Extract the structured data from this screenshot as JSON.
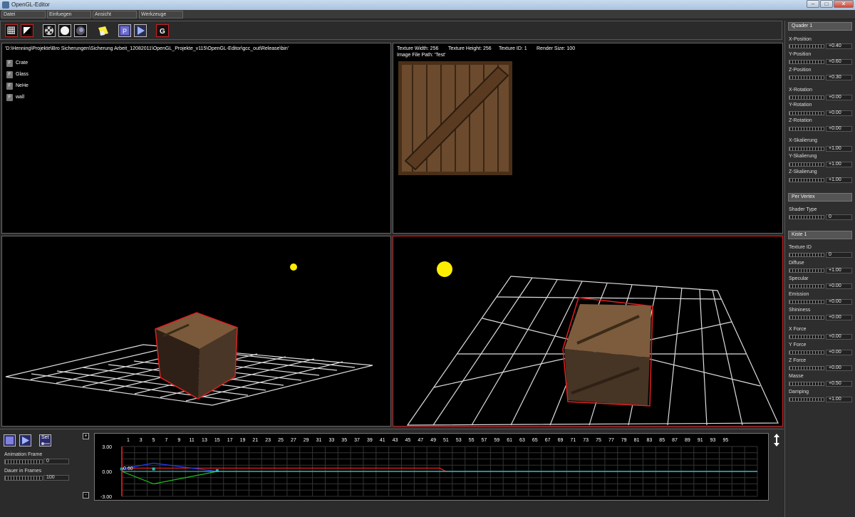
{
  "window": {
    "title": "OpenGL-Editor"
  },
  "menu": [
    "Datei",
    "Einfuegen",
    "Ansicht",
    "Werkzeuge"
  ],
  "toolbar": {
    "g_label": "G",
    "p_label": "P",
    "icons": [
      "grid-icon",
      "contrast-icon",
      "checker-icon",
      "sphere-white-icon",
      "sphere-blue-icon",
      "light-icon",
      "p-icon",
      "play-icon",
      "g-icon"
    ]
  },
  "file_browser": {
    "path": "'D:\\Henning\\Projekte\\Bro Sicherungen\\Sicherung Arbeit_12082011\\OpenGL_Projekte_v115\\OpenGL-Editor\\gcc_out\\Release\\bin'",
    "items": [
      {
        "icon": "F",
        "name": "Crate"
      },
      {
        "icon": "F",
        "name": "Glass"
      },
      {
        "icon": "F",
        "name": "NeHe"
      },
      {
        "icon": "F",
        "name": "wall"
      }
    ]
  },
  "texture_info": {
    "width_label": "Texture Width: 256",
    "height_label": "Texture Height: 256",
    "id_label": "Texture ID: 1",
    "render_label": "Render Size: 100",
    "path_label": "Image File Path: 'Test'"
  },
  "properties": {
    "object_name": "Quader 1",
    "transform": [
      {
        "label": "X-Position",
        "value": "+0.40"
      },
      {
        "label": "Y-Position",
        "value": "+0.60"
      },
      {
        "label": "Z-Position",
        "value": "+0.30"
      },
      {
        "label": "X-Rotation",
        "value": "+0.00"
      },
      {
        "label": "Y-Rotation",
        "value": "+0.00"
      },
      {
        "label": "Z-Rotation",
        "value": "+0.00"
      },
      {
        "label": "X-Skalierung",
        "value": "+1.00"
      },
      {
        "label": "Y-Skalierung",
        "value": "+1.00"
      },
      {
        "label": "Z-Skalierung",
        "value": "+1.00"
      }
    ],
    "shading_mode": "Per Vertex",
    "shader_type_label": "Shader Type",
    "shader_type_value": "0",
    "material_name": "Kiste 1",
    "material": [
      {
        "label": "Texture ID",
        "value": "0"
      },
      {
        "label": "Diffuse",
        "value": "+1.00"
      },
      {
        "label": "Specular",
        "value": "+0.00"
      },
      {
        "label": "Emission",
        "value": "+0.00"
      },
      {
        "label": "Shininess",
        "value": "+0.00"
      },
      {
        "label": "X Force",
        "value": "+0.00"
      },
      {
        "label": "Y Force",
        "value": "+0.00"
      },
      {
        "label": "Z Force",
        "value": "+0.00"
      },
      {
        "label": "Masse",
        "value": "+0.50"
      },
      {
        "label": "Damping",
        "value": "+1.00"
      }
    ]
  },
  "animation": {
    "set_label": "Set",
    "frame_label": "Animation Frame",
    "frame_value": "0",
    "duration_label": "Dauer in Frames",
    "duration_value": "100",
    "plus_label": "+",
    "minus_label": "-"
  },
  "chart_data": {
    "type": "line",
    "x_ticks": [
      "1",
      "3",
      "5",
      "7",
      "9",
      "11",
      "13",
      "15",
      "17",
      "19",
      "21",
      "23",
      "25",
      "27",
      "29",
      "31",
      "33",
      "35",
      "37",
      "39",
      "41",
      "43",
      "45",
      "47",
      "49",
      "51",
      "53",
      "55",
      "57",
      "59",
      "61",
      "63",
      "65",
      "67",
      "69",
      "71",
      "73",
      "75",
      "77",
      "79",
      "81",
      "83",
      "85",
      "87",
      "89",
      "91",
      "93",
      "95"
    ],
    "y_ticks": [
      "3.00",
      "0.00",
      "-3.00"
    ],
    "ylim": [
      -3,
      3
    ],
    "xlim": [
      0,
      100
    ],
    "point_label": "0.60",
    "series": [
      {
        "color": "#ff2020",
        "points": [
          [
            0,
            0.4
          ],
          [
            5,
            0.4
          ],
          [
            50,
            0.4
          ],
          [
            51,
            0
          ],
          [
            100,
            0
          ]
        ]
      },
      {
        "color": "#2040ff",
        "points": [
          [
            0,
            0.3
          ],
          [
            5,
            1.0
          ],
          [
            15,
            0
          ],
          [
            100,
            0
          ]
        ]
      },
      {
        "color": "#20c020",
        "points": [
          [
            0,
            0
          ],
          [
            5,
            -1.5
          ],
          [
            15,
            0
          ],
          [
            100,
            0
          ]
        ]
      },
      {
        "color": "#20c0c0",
        "points": [
          [
            0,
            0
          ],
          [
            100,
            0
          ]
        ]
      }
    ]
  },
  "colors": {
    "selection": "#cc2222",
    "light": "#ffee00",
    "grid": "#dddddd"
  }
}
